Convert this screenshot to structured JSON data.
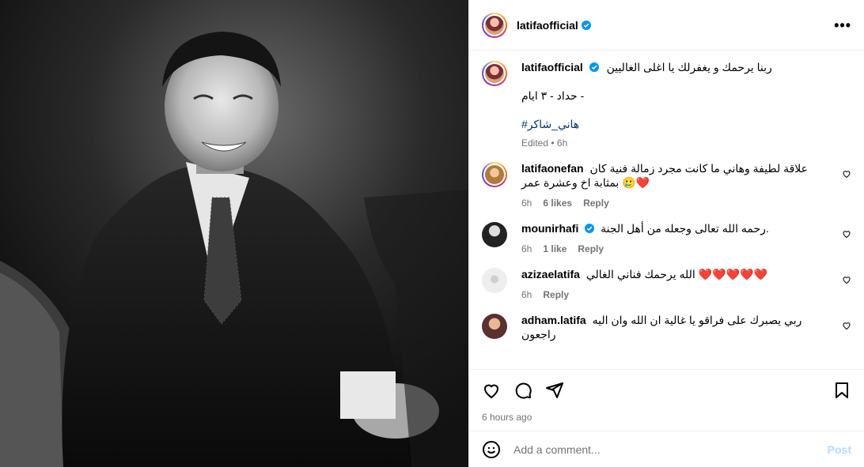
{
  "post": {
    "photo_alt": "",
    "author": "latifaofficial",
    "more_label": "•••"
  },
  "caption": {
    "author": "latifaofficial",
    "line1": "ربنا يرحمك و يغفرلك يا اغلى الغاليين",
    "line2": "حداد - ٣ ايام -",
    "hashtag": "#هاني_شاكر",
    "meta": "Edited • 6h"
  },
  "comments": [
    {
      "user": "latifaonefan",
      "text": "علاقة لطيفة وهاني ما كانت مجرد زمالة فنية كان بمثابة اخ وعشرة عمر 🥲❤️",
      "time": "6h",
      "likes": "6 likes",
      "reply": "Reply"
    },
    {
      "user": "mounirhafi",
      "verified": true,
      "text": "رحمه الله تعالى وجعله من أهل الجنة.",
      "time": "6h",
      "likes": "1 like",
      "reply": "Reply"
    },
    {
      "user": "azizaelatifa",
      "text": "الله يرحمك فناني الغالي ❤️❤️❤️❤️❤️",
      "time": "6h",
      "reply": "Reply"
    },
    {
      "user": "adham.latifa",
      "text": "ربي يصبرك على فراقو يا غالية ان الله وان اليه راجعون"
    }
  ],
  "footer": {
    "timestamp": "6 hours ago",
    "comment_placeholder": "Add a comment...",
    "post_label": "Post"
  },
  "colors": {
    "verified": "#0095f6",
    "link": "#00376b",
    "muted": "#737373",
    "post_disabled": "#b3dbff"
  }
}
